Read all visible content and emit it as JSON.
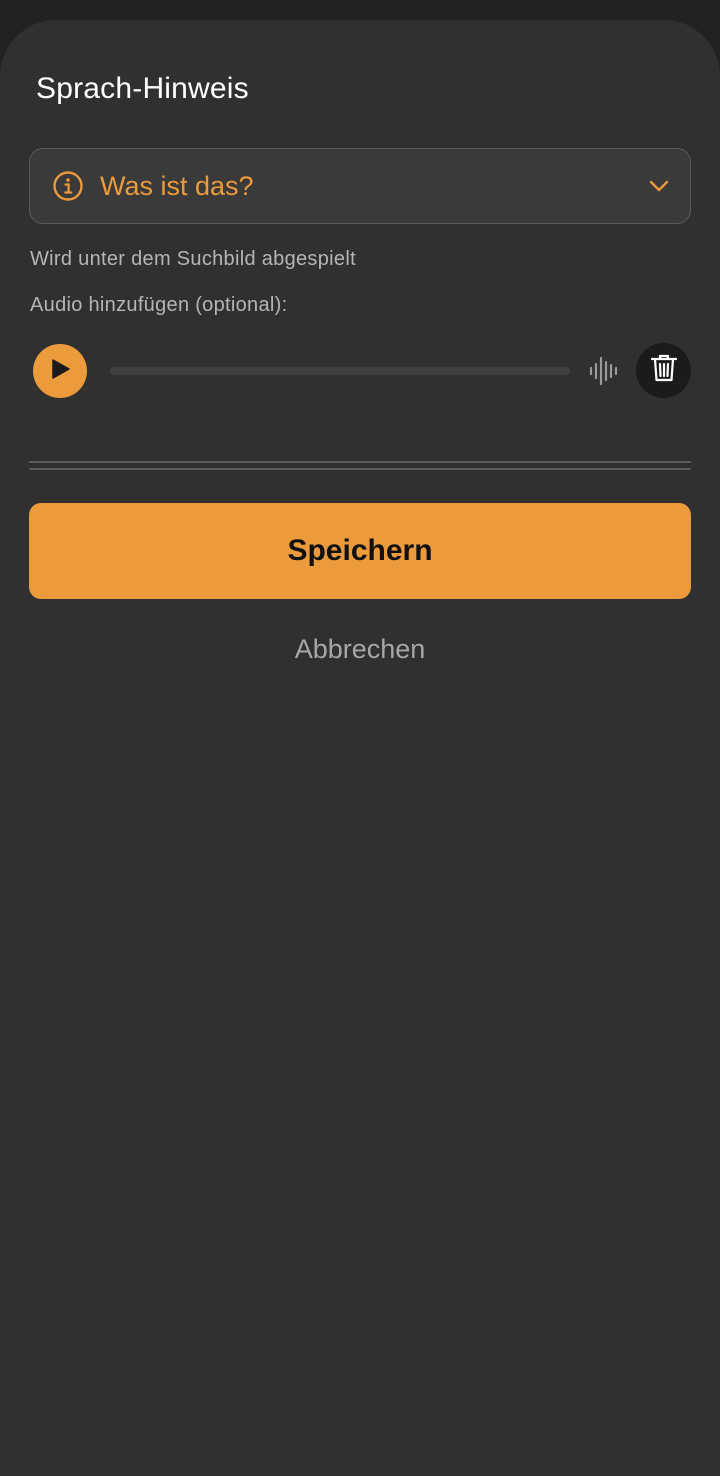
{
  "sheet": {
    "title": "Sprach-Hinweis"
  },
  "hint_dropdown": {
    "selected_value": "Was ist das?",
    "icon": "info-icon",
    "expand_icon": "chevron-down-icon"
  },
  "helper_text": "Wird unter dem Suchbild abgespielt",
  "audio": {
    "label": "Audio hinzufügen (optional):",
    "play_icon": "play-icon",
    "waveform_icon": "waveform-icon",
    "delete_icon": "trash-icon",
    "progress": 0
  },
  "actions": {
    "save_label": "Speichern",
    "cancel_label": "Abbrechen"
  },
  "colors": {
    "accent": "#eb9a3c",
    "sheet_background": "#303030",
    "field_background": "#3a3a3a",
    "secondary_text": "#b5b5b5"
  }
}
